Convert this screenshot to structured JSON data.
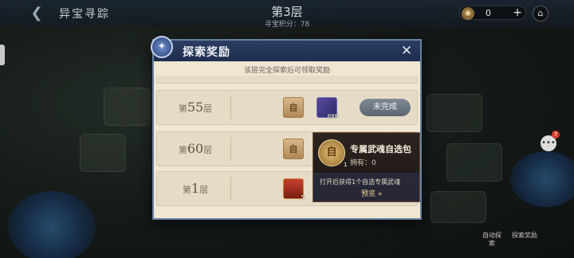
{
  "header": {
    "back_icon": "arrow-left-icon",
    "title": "异宝寻踪",
    "floor": "第3层",
    "score_label": "寻宝积分：78",
    "currency_value": "0",
    "currency_plus": "+",
    "home_icon": "home-icon"
  },
  "modal": {
    "title": "探索奖励",
    "subtitle": "该层完全探索后可领取奖励",
    "close_icon": "close-icon",
    "rows": [
      {
        "floor_prefix": "第",
        "floor_number": "55",
        "floor_suffix": "层",
        "items": [
          {
            "label": "自",
            "qty": ""
          },
          {
            "label": "",
            "qty": "888"
          }
        ],
        "status": "未完成"
      },
      {
        "floor_prefix": "第",
        "floor_number": "60",
        "floor_suffix": "层",
        "items": [
          {
            "label": "自",
            "qty": ""
          }
        ],
        "status": ""
      },
      {
        "floor_prefix": "第",
        "floor_number": "1",
        "floor_suffix": "层",
        "items": [
          {
            "label": "",
            "qty": "5"
          }
        ],
        "status": ""
      }
    ]
  },
  "tooltip": {
    "icon_label": "自",
    "icon_qty": "1",
    "title": "专属武魂自选包",
    "owned": "拥有：0",
    "description": "打开后获得1个自选专属武魂",
    "preview": "预览 »"
  },
  "right_panel": {
    "chat_badge": "7",
    "chat_icon": "chat-icon"
  },
  "bottom": {
    "auto_label": "自动探索",
    "explore_label": "探索奖励"
  }
}
